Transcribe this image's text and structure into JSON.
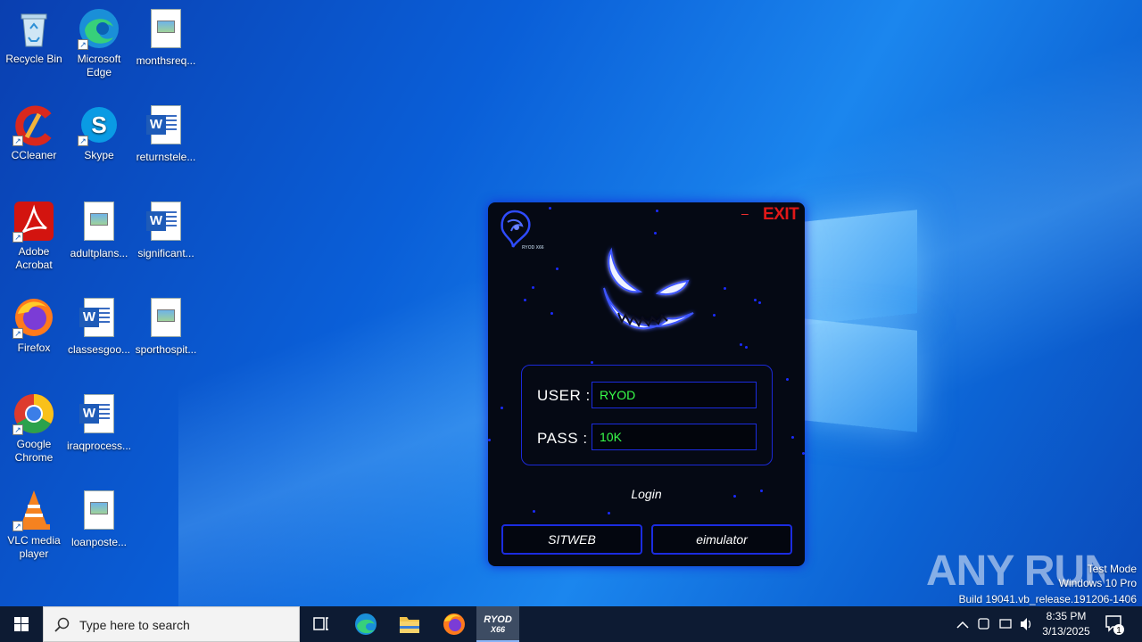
{
  "desktop": {
    "icons": [
      {
        "label": "Recycle Bin",
        "icon": "recycle-bin-icon"
      },
      {
        "label": "Microsoft Edge",
        "icon": "edge-icon"
      },
      {
        "label": "monthsreq...",
        "icon": "image-file-icon"
      },
      {
        "label": "CCleaner",
        "icon": "ccleaner-icon"
      },
      {
        "label": "Skype",
        "icon": "skype-icon"
      },
      {
        "label": "returnstele...",
        "icon": "word-document-icon"
      },
      {
        "label": "Adobe Acrobat",
        "icon": "acrobat-icon"
      },
      {
        "label": "adultplans...",
        "icon": "image-file-icon"
      },
      {
        "label": "significant...",
        "icon": "word-document-icon"
      },
      {
        "label": "Firefox",
        "icon": "firefox-icon"
      },
      {
        "label": "classesgoo...",
        "icon": "word-document-icon"
      },
      {
        "label": "sporthospit...",
        "icon": "image-file-icon"
      },
      {
        "label": "Google Chrome",
        "icon": "chrome-icon"
      },
      {
        "label": "iraqprocess...",
        "icon": "word-document-icon"
      },
      {
        "label": "VLC media player",
        "icon": "vlc-icon"
      },
      {
        "label": "loanposte...",
        "icon": "image-file-icon"
      }
    ]
  },
  "login_window": {
    "logo_text": "RYOD X66",
    "minimize_label": "–",
    "exit_label": "EXIT",
    "user_label": "USER :",
    "user_value": "RYOD",
    "pass_label": "PASS :",
    "pass_value": "10K",
    "login_label": "Login",
    "sitweb_label": "SITWEB",
    "emulator_label": "eimulator"
  },
  "watermark": {
    "brand": "ANY RUN",
    "test_mode": "Test Mode",
    "edition": "Windows 10 Pro",
    "build": "Build 19041.vb_release.191206-1406"
  },
  "taskbar": {
    "search_placeholder": "Type here to search",
    "active_app_label": "RYOD X66",
    "time": "8:35 PM",
    "date": "3/13/2025",
    "notification_count": "1"
  },
  "colors": {
    "window_bg": "#050914",
    "accent_blue": "#1b2ce0",
    "field_text": "#39ff4a",
    "exit_red": "#e01818",
    "taskbar_bg": "#0d1b33"
  }
}
